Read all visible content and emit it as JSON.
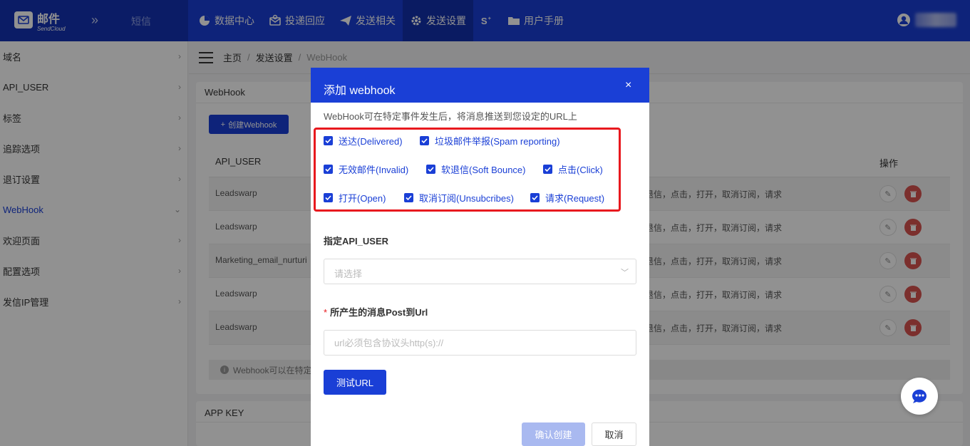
{
  "logo": {
    "title": "邮件",
    "subtitle": "SendCloud"
  },
  "header": {
    "collapse": "»",
    "sms": "短信",
    "nav": [
      {
        "label": "数据中心",
        "icon": "pie-chart-icon"
      },
      {
        "label": "投递回应",
        "icon": "mail-response-icon"
      },
      {
        "label": "发送相关",
        "icon": "paper-plane-icon"
      },
      {
        "label": "发送设置",
        "icon": "gear-icon",
        "active": true
      },
      {
        "label": "",
        "icon": "s-plus-icon"
      },
      {
        "label": "用户手册",
        "icon": "folder-icon"
      }
    ]
  },
  "sidebar": {
    "items": [
      {
        "label": "域名",
        "chev": "›"
      },
      {
        "label": "API_USER",
        "chev": "›"
      },
      {
        "label": "标签",
        "chev": "›"
      },
      {
        "label": "追踪选项",
        "chev": "›"
      },
      {
        "label": "退订设置",
        "chev": "›"
      },
      {
        "label": "WebHook",
        "chev": "⌄",
        "active": true
      },
      {
        "label": "欢迎页面",
        "chev": "›"
      },
      {
        "label": "配置选项",
        "chev": "›"
      },
      {
        "label": "发信IP管理",
        "chev": "›"
      }
    ]
  },
  "breadcrumb": {
    "home": "主页",
    "sep": "/",
    "section": "发送设置",
    "current": "WebHook"
  },
  "webhook_card": {
    "title": "WebHook",
    "create_button": "创建Webhook",
    "create_icon": "+",
    "columns": {
      "api_user": "API_USER",
      "actions": "操作"
    },
    "rows": [
      {
        "api_user": "Leadswarp",
        "events": "退信，点击，打开，取消订阅，请求"
      },
      {
        "api_user": "Leadswarp",
        "events": "退信，点击，打开，取消订阅，请求"
      },
      {
        "api_user": "Marketing_email_nurturi",
        "events": "退信，点击，打开，取消订阅，请求"
      },
      {
        "api_user": "Leadswarp",
        "events": "退信，点击，打开，取消订阅，请求"
      },
      {
        "api_user": "Leadswarp",
        "events": "退信，点击，打开，取消订阅，请求"
      }
    ],
    "tip_icon": "i",
    "tip": "Webhook可以在特定"
  },
  "appkey_card": {
    "title": "APP KEY"
  },
  "modal": {
    "title": "添加 webhook",
    "close": "×",
    "description": "WebHook可在特定事件发生后，将消息推送到您设定的URL上",
    "events": [
      {
        "label": "送达(Delivered)",
        "checked": true
      },
      {
        "label": "垃圾邮件举报(Spam reporting)",
        "checked": true
      },
      {
        "label": "无效邮件(Invalid)",
        "checked": true
      },
      {
        "label": "软退信(Soft Bounce)",
        "checked": true
      },
      {
        "label": "点击(Click)",
        "checked": true
      },
      {
        "label": "打开(Open)",
        "checked": true
      },
      {
        "label": "取消订阅(Unsubcribes)",
        "checked": true
      },
      {
        "label": "请求(Request)",
        "checked": true
      }
    ],
    "api_user_label": "指定API_USER",
    "select_placeholder": "请选择",
    "url_label": "所产生的消息Post到Url",
    "url_required_mark": "*",
    "url_placeholder": "url必须包含协议头http(s)://",
    "test_button": "测试URL",
    "confirm_button": "确认创建",
    "cancel_button": "取消"
  },
  "colors": {
    "primary": "#1a3fd6",
    "highlight": "#e8191e",
    "danger": "#d9534f"
  }
}
